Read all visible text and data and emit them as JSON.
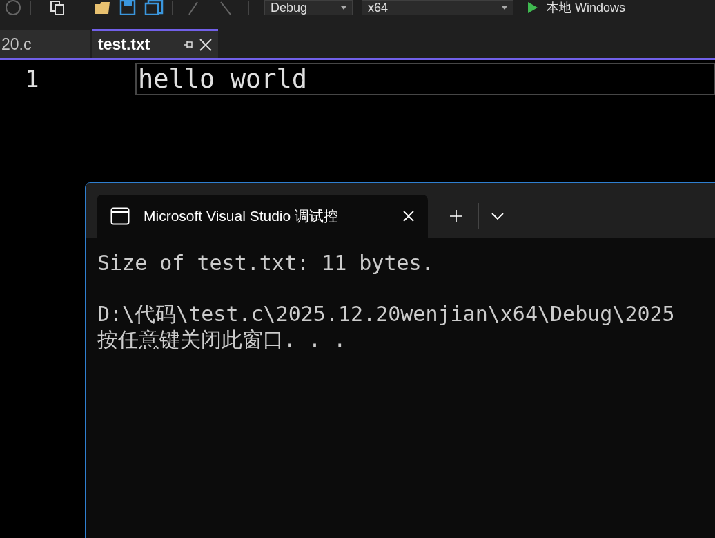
{
  "toolbar": {
    "configuration": "Debug",
    "platform": "x64",
    "run_target": "本地 Windows"
  },
  "tabs": [
    {
      "label": "20.c",
      "selected": false,
      "pinned": false
    },
    {
      "label": "test.txt",
      "selected": true,
      "pinned": true
    }
  ],
  "editor": {
    "lines": [
      {
        "number": "1",
        "text": "hello world",
        "current": true
      }
    ]
  },
  "console": {
    "tab": {
      "title": "Microsoft Visual Studio 调试控"
    },
    "output_blocks": [
      [
        "Size of test.txt: 11 bytes."
      ],
      [
        "D:\\代码\\test.c\\2025.12.20wenjian\\x64\\Debug\\2025",
        "按任意键关闭此窗口. . ."
      ]
    ]
  }
}
